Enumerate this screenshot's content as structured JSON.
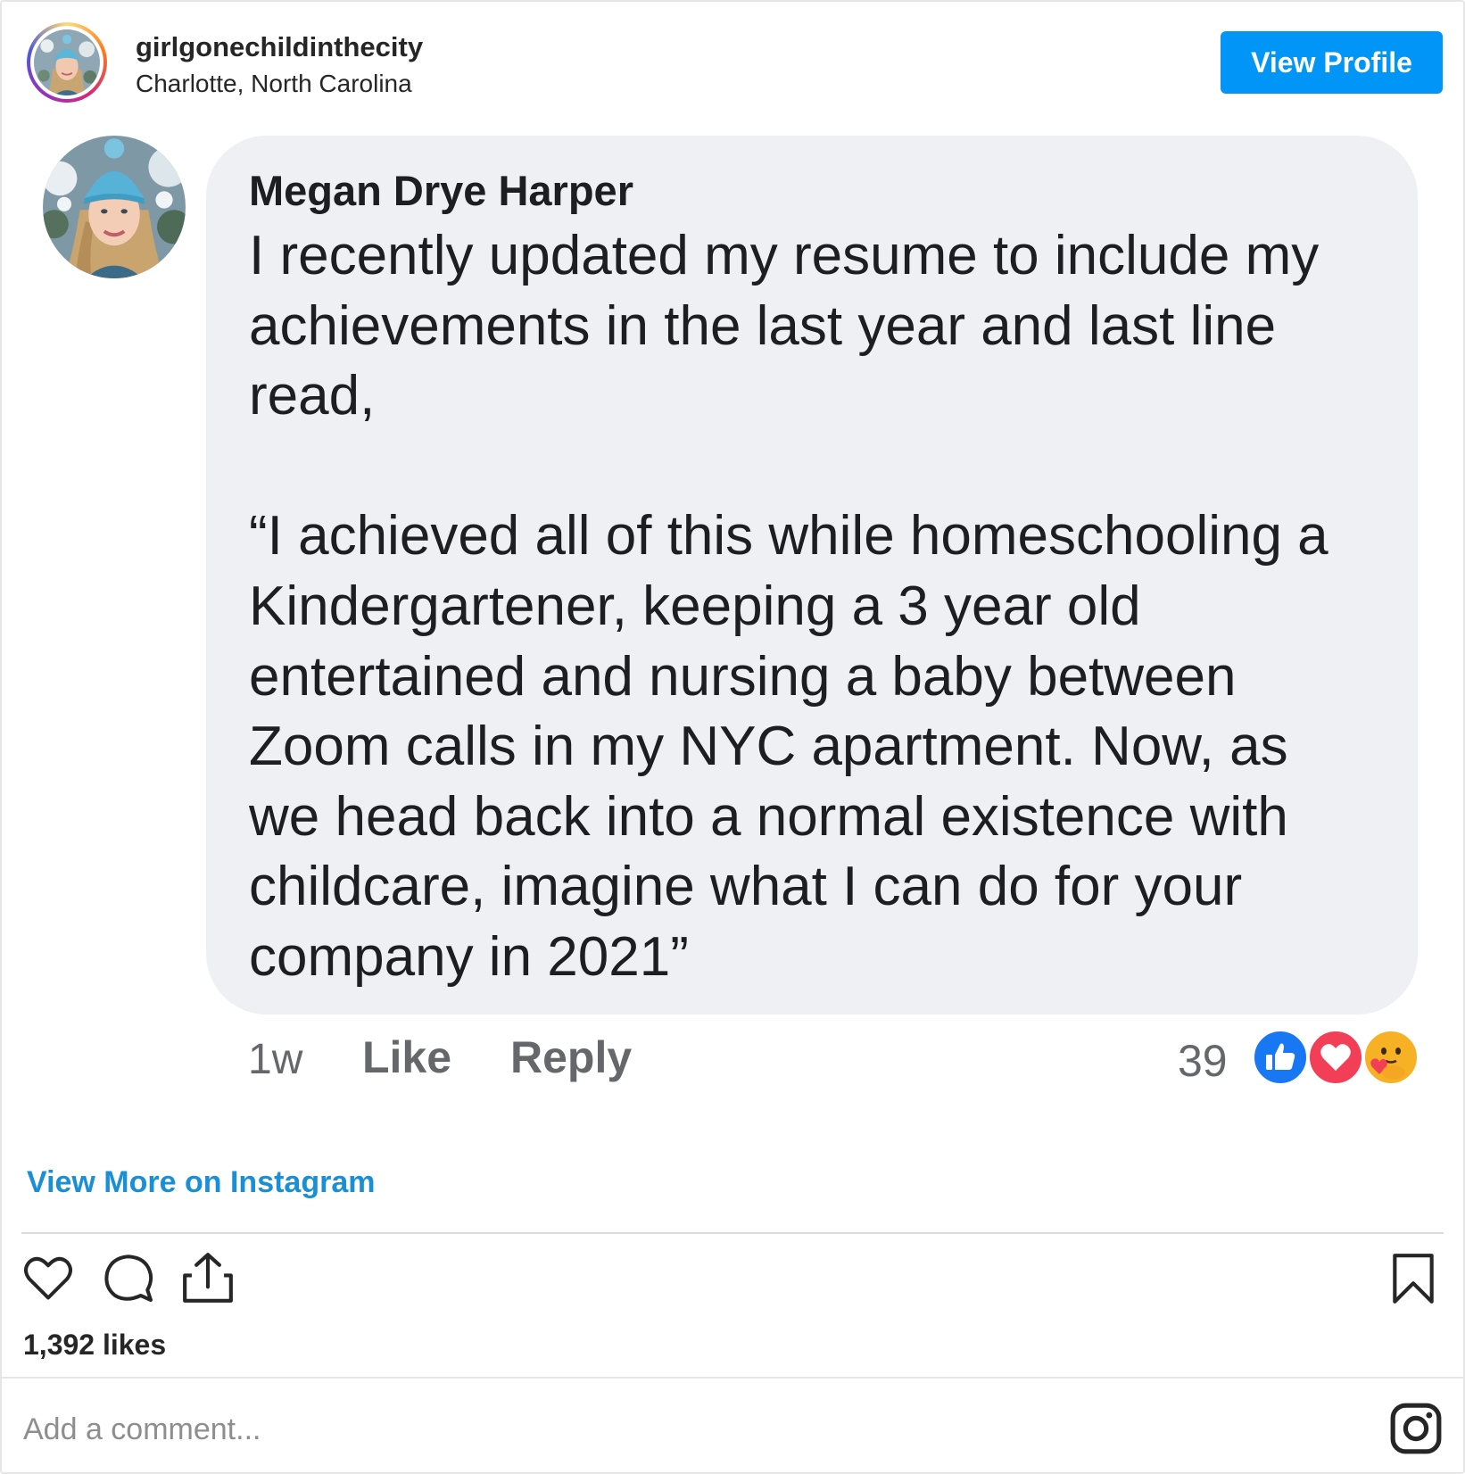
{
  "header": {
    "username": "girlgonechildinthecity",
    "location": "Charlotte, North Carolina",
    "view_profile_label": "View Profile"
  },
  "fb_comment": {
    "author": "Megan Drye Harper",
    "lines_before": [
      "I recently updated my resume to include my",
      "achievements in the last year and last line",
      "read,"
    ],
    "lines_after": [
      "“I achieved all of this while homeschooling a",
      "Kindergartener, keeping a 3 year old",
      "entertained and nursing a baby between",
      "Zoom calls in my NYC apartment. Now, as",
      "we head back into a normal existence with",
      "childcare, imagine what I can do for your",
      "company in 2021”"
    ],
    "time": "1w",
    "like_label": "Like",
    "reply_label": "Reply",
    "reaction_count": "39",
    "reaction_icons": [
      "like-reaction-icon",
      "love-reaction-icon",
      "care-reaction-icon"
    ],
    "colors": {
      "bubble": "#eff0f3",
      "like_blue": "#1877f2",
      "love_red": "#f33e58",
      "care_yellow": "#f7b125"
    }
  },
  "footer": {
    "view_more_label": "View More on Instagram",
    "likes_text": "1,392 likes",
    "comment_placeholder": "Add a comment...",
    "icons": [
      "heart-icon",
      "comment-icon",
      "share-icon",
      "bookmark-icon",
      "instagram-logo-icon"
    ]
  },
  "colors": {
    "accent": "#0095f6",
    "link": "#1b8fd6",
    "text": "#262626",
    "muted": "#65676b"
  }
}
